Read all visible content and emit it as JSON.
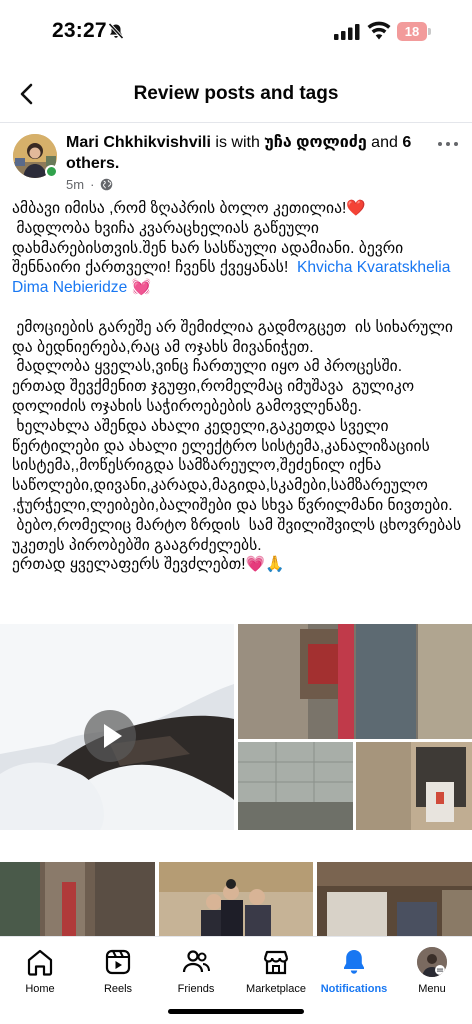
{
  "status_bar": {
    "time": "23:27",
    "battery": "18",
    "icons": [
      "bell-slash-icon",
      "signal-icon",
      "wifi-icon",
      "battery-icon"
    ]
  },
  "header": {
    "title": "Review posts and tags",
    "back_icon": "back-chevron-icon"
  },
  "post": {
    "author": "Mari Chkhikvishvili",
    "with_text": "is with",
    "tagged_person": "უჩა დოლიძე",
    "and_text": "and",
    "others": "6 others.",
    "time": "5m",
    "dot": "·",
    "privacy_icon": "globe-icon",
    "menu_icon": "more-icon",
    "text": {
      "p1": "ამბავი იმისა ,რომ ზღაპრის ბოლო კეთილია!❤️\n მადლობა ხვიჩა კვარაცხელიას გაწეული დახმარებისთვის.შენ ხარ სასწაული ადამიანი. ბევრი შენნაირი ქართველი! ჩვენს ქვეყანას!",
      "tag1": "Khvicha Kvaratskhelia",
      "tag2": "Dima Nebieridze",
      "heart": "💓",
      "p2": " ემოციების გარეშე არ შემიძლია გადმოგცეთ  ის სიხარული და ბედნიერება,რაც ამ ოჯახს მივანიჭეთ.\n მადლობა ყველას,ვინც ჩართული იყო ამ პროცესში.\nერთად შევქმენით ჯგუფი,რომელმაც იმუშავა  გულიკო დოლიძის ოჯახის საჭიროებების გამოვლენაზე.\n ხელახლა აშენდა ახალი კედელი,გაკეთდა სველი წერტილები და ახალი ელექტრო სისტემა,კანალიზაციის სისტემა,,მოწესრიგდა სამზარეულო,შეძენილ იქნა საწოლები,დივანი,კარადა,მაგიდა,სკამები,სამზარეულო ,ჭურჭელი,ლეიბები,ბალიშები და სხვა წვრილმანი ნივთები.\n ბებო,რომელიც მარტო ზრდის  სამ შვილიშვილს ცხოვრებას უკეთეს პირობებში გააგრძელებს.\nერთად ყველაფერს შევძლებთ!💗🙏"
    }
  },
  "media": {
    "video_icon": "play-icon",
    "photos": [
      "photo-1",
      "photo-2",
      "photo-3",
      "photo-4",
      "photo-5",
      "photo-6"
    ]
  },
  "bottom_nav": {
    "items": [
      {
        "label": "Home",
        "icon": "home-icon"
      },
      {
        "label": "Reels",
        "icon": "reels-icon"
      },
      {
        "label": "Friends",
        "icon": "friends-icon"
      },
      {
        "label": "Marketplace",
        "icon": "marketplace-icon"
      },
      {
        "label": "Notifications",
        "icon": "bell-icon",
        "active": true
      },
      {
        "label": "Menu",
        "icon": "menu-avatar"
      }
    ],
    "active_color": "#1877f2"
  }
}
